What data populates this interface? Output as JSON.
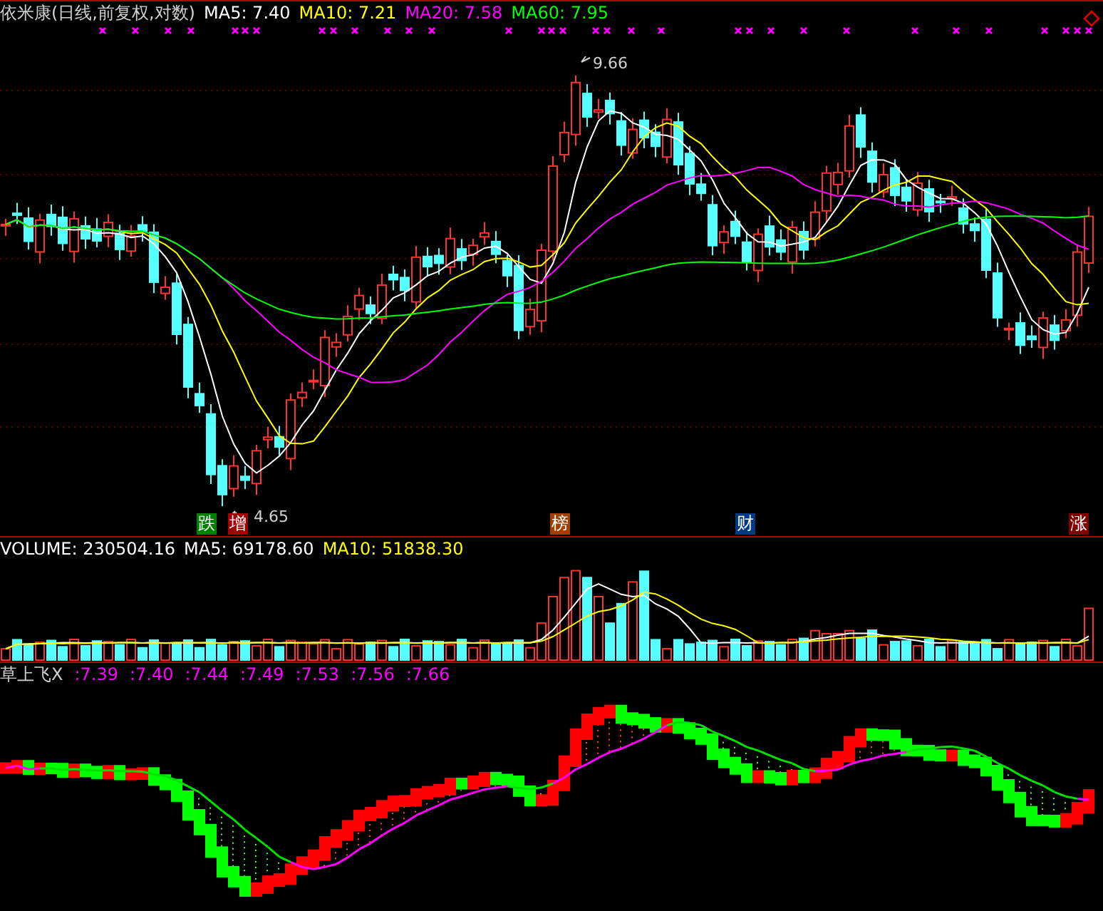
{
  "price_panel": {
    "title": "依米康(日线,前复权,对数)",
    "indicators": [
      {
        "label": "MA5: 7.40",
        "color": "#ffffff"
      },
      {
        "label": "MA10: 7.21",
        "color": "#ffff00"
      },
      {
        "label": "MA20: 7.58",
        "color": "#ff00ff"
      },
      {
        "label": "MA60: 7.95",
        "color": "#00ff00"
      }
    ],
    "high_label": "9.66",
    "low_label": "4.65",
    "markers": [
      {
        "text": "跌",
        "color": "#008000"
      },
      {
        "text": "增",
        "color": "#a00000"
      },
      {
        "text": "榜",
        "color": "#a04000"
      },
      {
        "text": "财",
        "color": "#003a80"
      },
      {
        "text": "涨",
        "color": "#800000"
      }
    ]
  },
  "volume_panel": {
    "indicators": [
      {
        "label": "VOLUME: 230504.16",
        "color": "#ffffff"
      },
      {
        "label": "MA5: 69178.60",
        "color": "#ffffff"
      },
      {
        "label": "MA10: 51838.30",
        "color": "#ffff00"
      }
    ]
  },
  "indicator_panel": {
    "title": "草上飞X",
    "values": [
      {
        "label": ":7.39",
        "color": "#ff00ff"
      },
      {
        "label": ":7.40",
        "color": "#ff00ff"
      },
      {
        "label": ":7.44",
        "color": "#ff00ff"
      },
      {
        "label": ":7.49",
        "color": "#ff00ff"
      },
      {
        "label": ":7.53",
        "color": "#ff00ff"
      },
      {
        "label": ":7.56",
        "color": "#ff00ff"
      },
      {
        "label": ":7.66",
        "color": "#ff00ff"
      }
    ]
  }
}
